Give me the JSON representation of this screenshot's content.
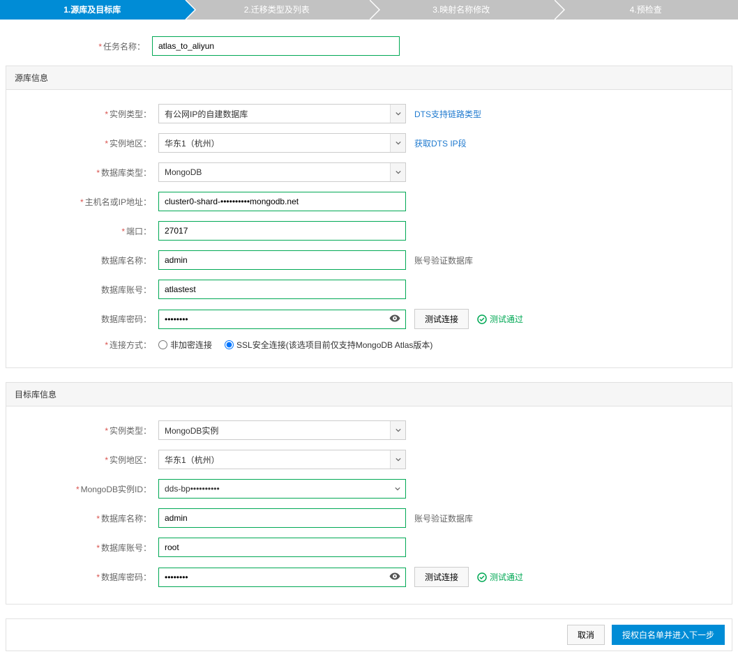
{
  "steps": {
    "s1": "1.源库及目标库",
    "s2": "2.迁移类型及列表",
    "s3": "3.映射名称修改",
    "s4": "4.预检查"
  },
  "labels": {
    "task_name": "任务名称：",
    "instance_type": "实例类型：",
    "instance_region": "实例地区：",
    "db_type": "数据库类型：",
    "host": "主机名或IP地址：",
    "port": "端口：",
    "db_name": "数据库名称：",
    "db_user": "数据库账号：",
    "db_password": "数据库密码：",
    "conn_method": "连接方式：",
    "mongo_instance_id": "MongoDB实例ID："
  },
  "panels": {
    "source_title": "源库信息",
    "target_title": "目标库信息"
  },
  "links": {
    "dts_link_type": "DTS支持链路类型",
    "get_dts_ip": "获取DTS IP段"
  },
  "side_notes": {
    "auth_db": "账号验证数据库"
  },
  "buttons": {
    "test_conn": "测试连接",
    "cancel": "取消",
    "next": "授权白名单并进入下一步"
  },
  "status": {
    "test_pass": "测试通过"
  },
  "conn": {
    "plain": "非加密连接",
    "ssl": "SSL安全连接(该选项目前仅支持MongoDB Atlas版本)"
  },
  "source": {
    "task_name_value": "atlas_to_aliyun",
    "instance_type_value": "有公网IP的自建数据库",
    "instance_region_value": "华东1（杭州）",
    "db_type_value": "MongoDB",
    "host_value": "cluster0-shard-••••••••••mongodb.net",
    "port_value": "27017",
    "db_name_value": "admin",
    "db_user_value": "atlastest",
    "db_password_value": "••••••••"
  },
  "target": {
    "instance_type_value": "MongoDB实例",
    "instance_region_value": "华东1（杭州）",
    "mongo_id_value": "dds-bp••••••••••",
    "db_name_value": "admin",
    "db_user_value": "root",
    "db_password_value": "••••••••"
  }
}
